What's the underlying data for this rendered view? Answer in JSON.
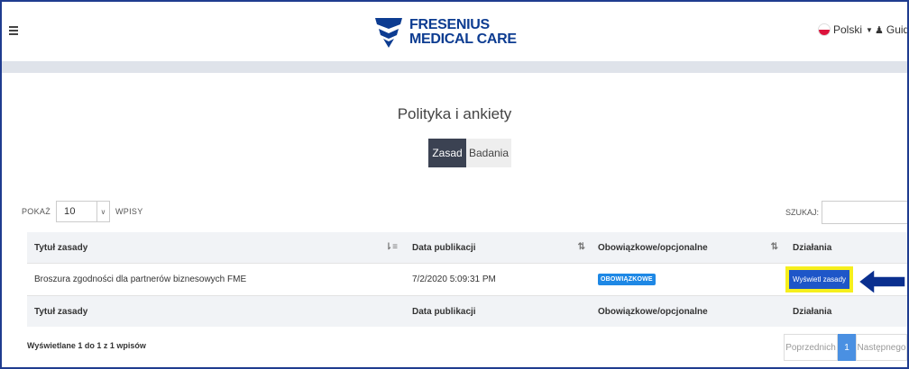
{
  "header": {
    "brand_line1": "FRESENIUS",
    "brand_line2": "MEDICAL CARE",
    "language": "Polski",
    "user": "Guid",
    "colors": {
      "brand": "#0d3c91",
      "frame": "#1f3c8f"
    }
  },
  "page": {
    "title": "Polityka i ankiety",
    "tabs": [
      {
        "label": "Zasad",
        "active": true
      },
      {
        "label": "Badania",
        "active": false
      }
    ]
  },
  "controls": {
    "show_label": "POKAŻ",
    "page_size": "10",
    "entries_label": "WPISY",
    "search_label": "SZUKAJ:",
    "search_value": ""
  },
  "table": {
    "columns": [
      "Tytuł zasady",
      "Data publikacji",
      "Obowiązkowe/opcjonalne",
      "Działania"
    ],
    "rows": [
      {
        "title": "Broszura zgodności dla partnerów biznesowych FME",
        "date": "7/2/2020 5:09:31 PM",
        "status": "OBOWIĄZKOWE",
        "action": "Wyświetl zasady"
      }
    ],
    "footer_columns": [
      "Tytuł zasady",
      "Data publikacji",
      "Obowiązkowe/opcjonalne",
      "Działania"
    ]
  },
  "footer": {
    "info": "Wyświetlane 1 do 1 z 1 wpisów",
    "prev": "Poprzednich",
    "current_page": "1",
    "next": "Następnego"
  }
}
